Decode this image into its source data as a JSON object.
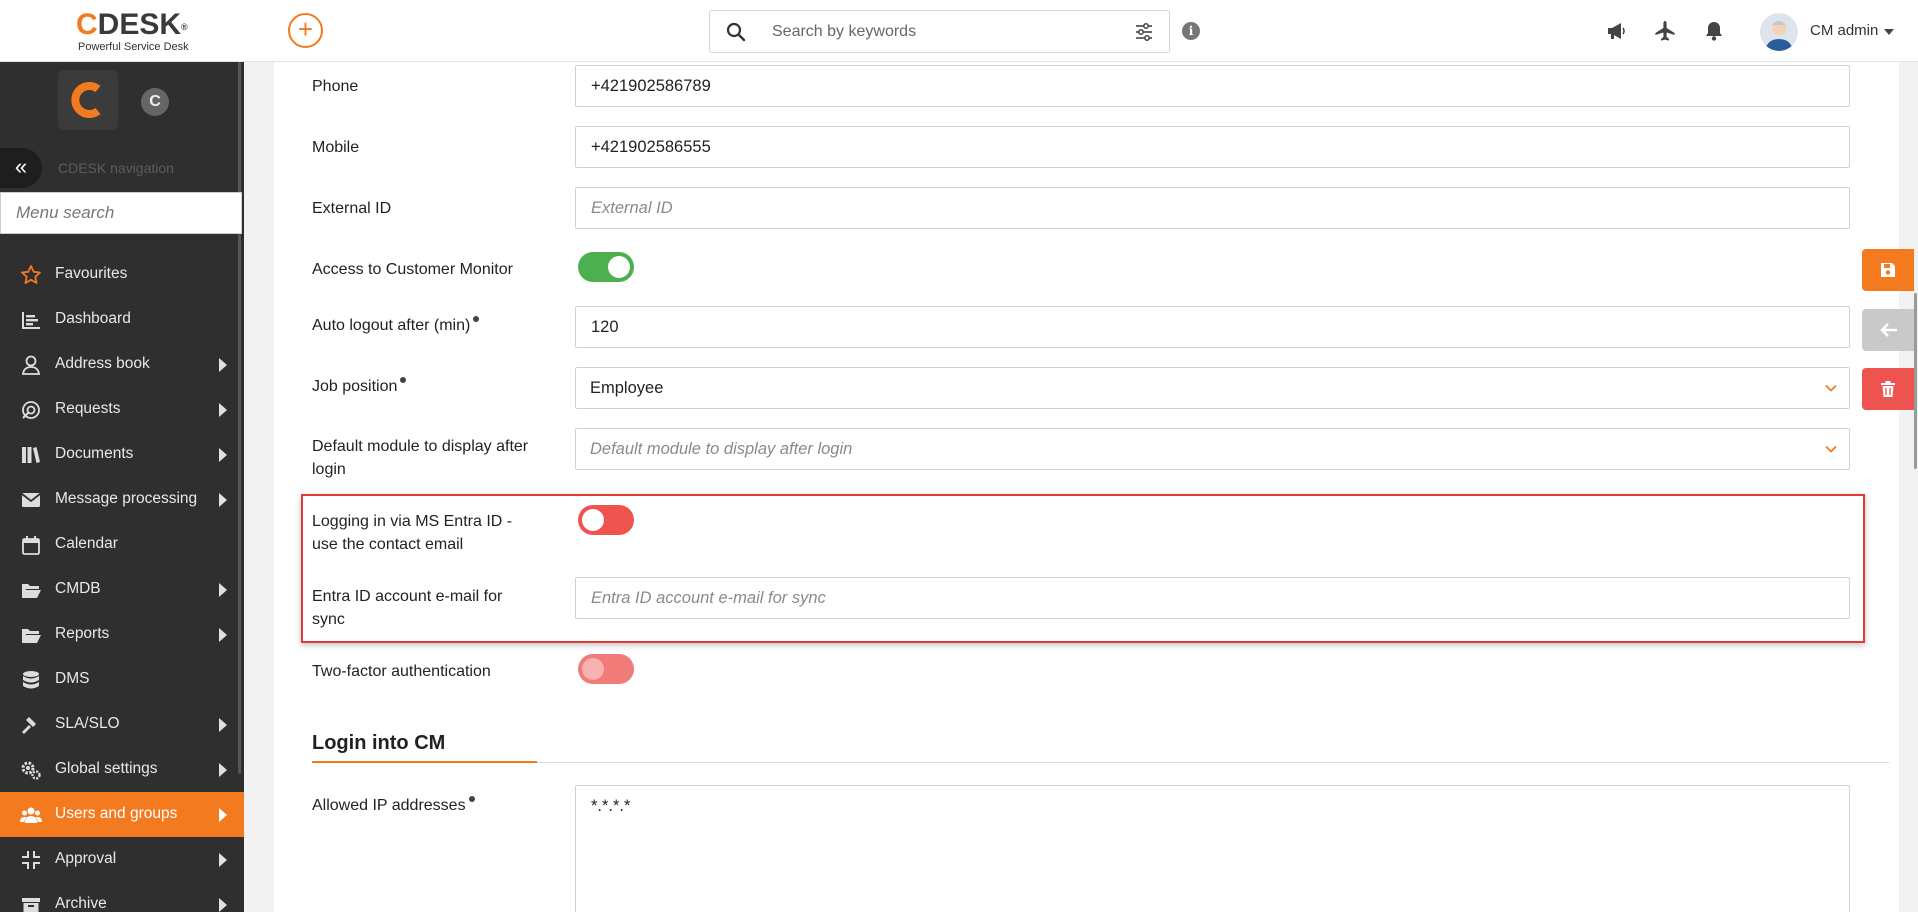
{
  "header": {
    "logo_text": "CDESK",
    "logo_tagline": "Powerful Service Desk",
    "search_placeholder": "Search by keywords",
    "user_name": "CM admin"
  },
  "sidebar": {
    "app_badge": "C",
    "nav_label": "CDESK navigation",
    "menu_search_placeholder": "Menu search",
    "items": [
      {
        "label": "Favourites",
        "icon": "star-icon",
        "has_submenu": false
      },
      {
        "label": "Dashboard",
        "icon": "dashboard-icon",
        "has_submenu": false
      },
      {
        "label": "Address book",
        "icon": "person-icon",
        "has_submenu": true
      },
      {
        "label": "Requests",
        "icon": "requests-icon",
        "has_submenu": true
      },
      {
        "label": "Documents",
        "icon": "documents-icon",
        "has_submenu": true
      },
      {
        "label": "Message processing",
        "icon": "envelope-icon",
        "has_submenu": true
      },
      {
        "label": "Calendar",
        "icon": "calendar-icon",
        "has_submenu": false
      },
      {
        "label": "CMDB",
        "icon": "folder-icon",
        "has_submenu": true
      },
      {
        "label": "Reports",
        "icon": "folder-icon",
        "has_submenu": true
      },
      {
        "label": "DMS",
        "icon": "database-icon",
        "has_submenu": false
      },
      {
        "label": "SLA/SLO",
        "icon": "hammer-icon",
        "has_submenu": true
      },
      {
        "label": "Global settings",
        "icon": "gears-icon",
        "has_submenu": true
      },
      {
        "label": "Users and groups",
        "icon": "users-icon",
        "has_submenu": true,
        "active": true
      },
      {
        "label": "Approval",
        "icon": "compress-icon",
        "has_submenu": true
      },
      {
        "label": "Archive",
        "icon": "archive-icon",
        "has_submenu": true
      }
    ]
  },
  "form": {
    "phone": {
      "label": "Phone",
      "value": "+421902586789"
    },
    "mobile": {
      "label": "Mobile",
      "value": "+421902586555"
    },
    "external_id": {
      "label": "External ID",
      "placeholder": "External ID"
    },
    "customer_monitor": {
      "label": "Access to Customer Monitor",
      "enabled": true
    },
    "auto_logout": {
      "label": "Auto logout after (min)",
      "value": "120"
    },
    "job_position": {
      "label": "Job position",
      "value": "Employee"
    },
    "default_module": {
      "label": "Default module to display after login",
      "placeholder": "Default module to display after login"
    },
    "entra_login": {
      "label": "Logging in via MS Entra ID - use the contact email",
      "enabled": false
    },
    "entra_email": {
      "label": "Entra ID account e-mail for sync",
      "placeholder": "Entra ID account e-mail for sync"
    },
    "two_factor": {
      "label": "Two-factor authentication",
      "enabled": false
    }
  },
  "login_section": {
    "title": "Login into CM",
    "allowed_ip": {
      "label": "Allowed IP addresses",
      "value": "*.*.*.*"
    }
  },
  "colors": {
    "accent": "#f47a20",
    "sidebar_bg": "#2f2f2f",
    "toggle_on": "#4caf50",
    "toggle_off": "#ee5350",
    "delete": "#ef5350",
    "highlight_border": "#e53935"
  }
}
